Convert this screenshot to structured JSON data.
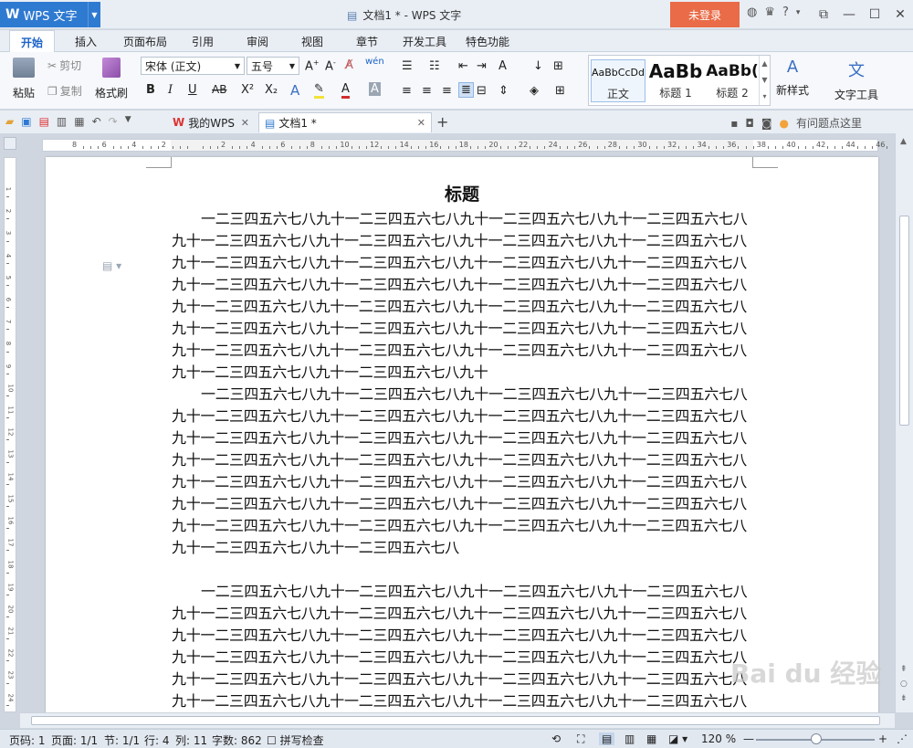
{
  "titlebar": {
    "app_name": "WPS 文字",
    "doc_title": "文档1 * - WPS 文字",
    "login_label": "未登录",
    "help_label": "?"
  },
  "tabs": [
    {
      "label": "开始",
      "active": true
    },
    {
      "label": "插入"
    },
    {
      "label": "页面布局"
    },
    {
      "label": "引用"
    },
    {
      "label": "审阅"
    },
    {
      "label": "视图"
    },
    {
      "label": "章节"
    },
    {
      "label": "开发工具"
    },
    {
      "label": "特色功能"
    }
  ],
  "ribbon": {
    "paste": "粘贴",
    "cut": "剪切",
    "copy": "复制",
    "format_painter": "格式刷",
    "font_name": "宋体 (正文)",
    "font_size": "五号",
    "bold": "B",
    "italic": "I",
    "underline": "U",
    "strike": "AB",
    "superscript": "X²",
    "subscript": "X₂",
    "styles": [
      {
        "preview": "AaBbCcDd",
        "label": "正文"
      },
      {
        "preview": "AaBb",
        "label": "标题 1"
      },
      {
        "preview": "AaBb(",
        "label": "标题 2"
      }
    ],
    "new_style": "新样式",
    "text_tools": "文字工具"
  },
  "quickbar": {
    "tab_mywps": "我的WPS",
    "tab_doc": "文档1 *",
    "help_text": "有问题点这里"
  },
  "document": {
    "heading": "标题",
    "paragraphs": [
      "一二三四五六七八九十一二三四五六七八九十一二三四五六七八九十一二三四五六七八九十一二三四五六七八九十一二三四五六七八九十一二三四五六七八九十一二三四五六七八九十一二三四五六七八九十一二三四五六七八九十一二三四五六七八九十一二三四五六七八九十一二三四五六七八九十一二三四五六七八九十一二三四五六七八九十一二三四五六七八九十一二三四五六七八九十一二三四五六七八九十一二三四五六七八九十一二三四五六七八九十一二三四五六七八九十一二三四五六七八九十一二三四五六七八九十一二三四五六七八九十一二三四五六七八九十一二三四五六七八九十一二三四五六七八九十一二三四五六七八九十一二三四五六七八九十一二三四五六七八九十",
      "一二三四五六七八九十一二三四五六七八九十一二三四五六七八九十一二三四五六七八九十一二三四五六七八九十一二三四五六七八九十一二三四五六七八九十一二三四五六七八九十一二三四五六七八九十一二三四五六七八九十一二三四五六七八九十一二三四五六七八九十一二三四五六七八九十一二三四五六七八九十一二三四五六七八九十一二三四五六七八九十一二三四五六七八九十一二三四五六七八九十一二三四五六七八九十一二三四五六七八九十一二三四五六七八九十一二三四五六七八九十一二三四五六七八九十一二三四五六七八九十一二三四五六七八九十一二三四五六七八九十一二三四五六七八九十一二三四五六七八九十一二三四五六七八九十一二三四五六七八",
      "一二三四五六七八九十一二三四五六七八九十一二三四五六七八九十一二三四五六七八九十一二三四五六七八九十一二三四五六七八九十一二三四五六七八九十一二三四五六七八九十一二三四五六七八九十一二三四五六七八九十一二三四五六七八九十一二三四五六七八九十一二三四五六七八九十一二三四五六七八九十一二三四五六七八九十一二三四五六七八九十一二三四五六七八九十一二三四五六七八九十一二三四五六七八九十一二三四五六七八九十一二三四五六七八九十一二三四五六七八九十一二三四五六七八九十一二三四五六七八九十"
    ]
  },
  "ruler": {
    "h_numbers": [
      "8",
      "6",
      "4",
      "2",
      "",
      "2",
      "4",
      "6",
      "8",
      "10",
      "12",
      "14",
      "16",
      "18",
      "20",
      "22",
      "24",
      "26",
      "28",
      "30",
      "32",
      "34",
      "36",
      "38",
      "40",
      "42",
      "44",
      "46"
    ],
    "v_numbers": [
      "1",
      "2",
      "3",
      "4",
      "5",
      "6",
      "7",
      "8",
      "9",
      "10",
      "11",
      "12",
      "13",
      "14",
      "15",
      "16",
      "17",
      "18",
      "19",
      "20",
      "21",
      "22",
      "23",
      "24"
    ]
  },
  "statusbar": {
    "page_num": "页码: 1",
    "page_count": "页面: 1/1",
    "section": "节: 1/1",
    "row": "行: 4",
    "col": "列: 11",
    "word_count": "字数: 862",
    "spell_check": "拼写检查",
    "zoom": "120 %"
  },
  "watermark": "Bai du 经验",
  "colors": {
    "accent": "#2f7ad1",
    "login_bg": "#e96b47",
    "tab_active": "#1b63c7"
  }
}
